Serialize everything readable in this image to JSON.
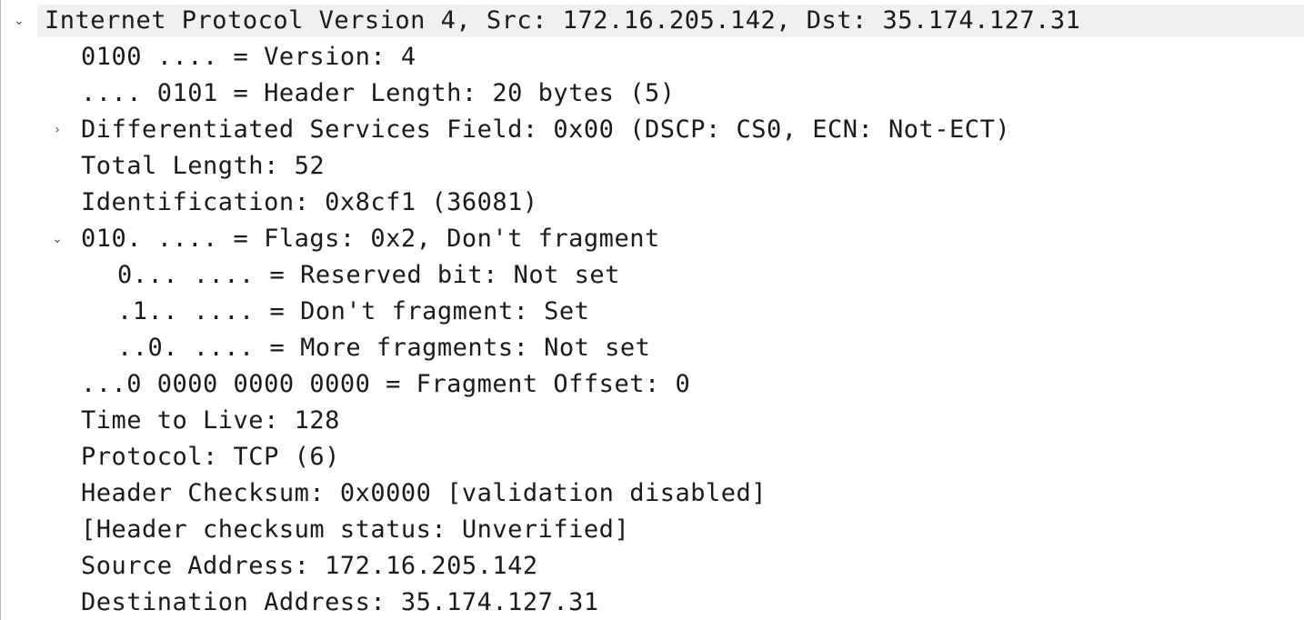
{
  "tree": {
    "ipv4_header": "Internet Protocol Version 4, Src: 172.16.205.142, Dst: 35.174.127.31",
    "version": "0100 .... = Version: 4",
    "header_length": ".... 0101 = Header Length: 20 bytes (5)",
    "dsfield": "Differentiated Services Field: 0x00 (DSCP: CS0, ECN: Not-ECT)",
    "total_length": "Total Length: 52",
    "identification": "Identification: 0x8cf1 (36081)",
    "flags": "010. .... = Flags: 0x2, Don't fragment",
    "flag_reserved": "0... .... = Reserved bit: Not set",
    "flag_df": ".1.. .... = Don't fragment: Set",
    "flag_mf": "..0. .... = More fragments: Not set",
    "fragment_offset": "...0 0000 0000 0000 = Fragment Offset: 0",
    "ttl": "Time to Live: 128",
    "protocol": "Protocol: TCP (6)",
    "checksum": "Header Checksum: 0x0000 [validation disabled]",
    "checksum_status": "[Header checksum status: Unverified]",
    "src": "Source Address: 172.16.205.142",
    "dst": "Destination Address: 35.174.127.31"
  },
  "icons": {
    "expanded": "chevron-down-icon",
    "collapsed": "chevron-right-icon"
  },
  "colors": {
    "text": "#1a1a1a",
    "highlight": "#f0f0f0",
    "expander": "#555555"
  }
}
